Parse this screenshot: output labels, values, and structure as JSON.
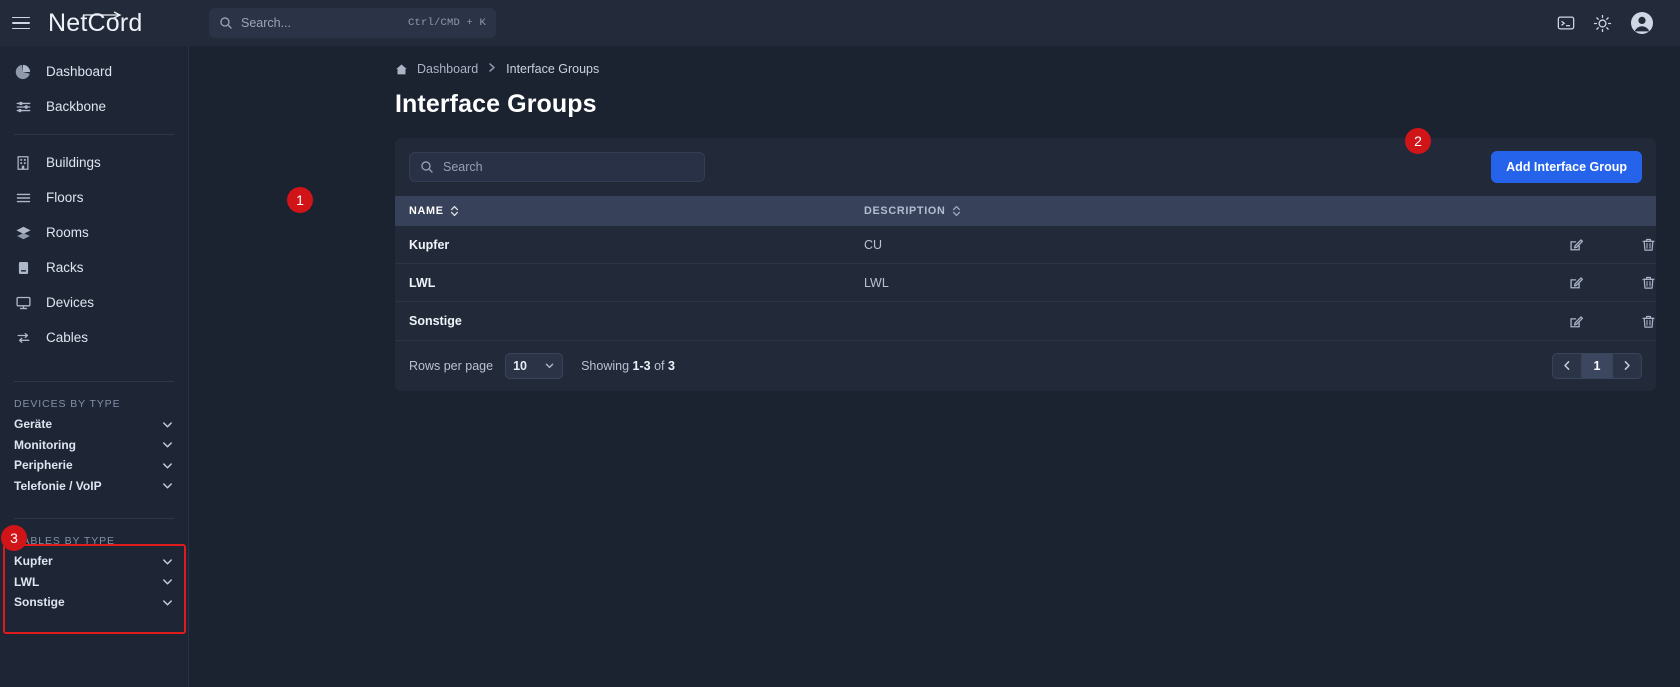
{
  "topbar": {
    "menu_icon": "hamburger-icon",
    "brand": "NetCord",
    "search": {
      "placeholder": "Search...",
      "shortcut": "Ctrl/CMD + K",
      "icon": "search-icon"
    },
    "actions": [
      {
        "name": "terminal-icon",
        "label": ""
      },
      {
        "name": "theme-toggle-icon",
        "label": ""
      },
      {
        "name": "user-avatar-icon",
        "label": ""
      }
    ]
  },
  "sidebar": {
    "primary": [
      {
        "label": "Dashboard",
        "icon": "pie-chart-icon"
      },
      {
        "label": "Backbone",
        "icon": "sliders-icon"
      }
    ],
    "secondary": [
      {
        "label": "Buildings",
        "icon": "building-icon"
      },
      {
        "label": "Floors",
        "icon": "layers-lines-icon"
      },
      {
        "label": "Rooms",
        "icon": "stack-icon"
      },
      {
        "label": "Racks",
        "icon": "rack-icon"
      },
      {
        "label": "Devices",
        "icon": "monitor-icon"
      },
      {
        "label": "Cables",
        "icon": "cable-swap-icon"
      }
    ],
    "devices_by_type": {
      "title": "DEVICES BY TYPE",
      "items": [
        {
          "label": "Geräte",
          "icon": "chevron-down-icon"
        },
        {
          "label": "Monitoring",
          "icon": "chevron-down-icon"
        },
        {
          "label": "Peripherie",
          "icon": "chevron-down-icon"
        },
        {
          "label": "Telefonie / VoIP",
          "icon": "chevron-down-icon"
        }
      ]
    },
    "cables_by_type": {
      "title": "CABLES BY TYPE",
      "items": [
        {
          "label": "Kupfer",
          "icon": "chevron-down-icon"
        },
        {
          "label": "LWL",
          "icon": "chevron-down-icon"
        },
        {
          "label": "Sonstige",
          "icon": "chevron-down-icon"
        }
      ]
    }
  },
  "breadcrumb": {
    "home_icon": "home-icon",
    "items": [
      "Dashboard",
      "Interface Groups"
    ],
    "separator": "›"
  },
  "page": {
    "title": "Interface Groups"
  },
  "toolbar": {
    "search_placeholder": "Search",
    "search_icon": "search-icon",
    "add_button": "Add Interface Group"
  },
  "table": {
    "columns": [
      {
        "key": "name",
        "label": "NAME",
        "sort_icon": "sort-updown-icon",
        "active": true
      },
      {
        "key": "description",
        "label": "DESCRIPTION",
        "sort_icon": "sort-updown-icon",
        "active": false
      }
    ],
    "rows": [
      {
        "name": "Kupfer",
        "description": "CU",
        "edit_icon": "edit-icon",
        "delete_icon": "trash-icon"
      },
      {
        "name": "LWL",
        "description": "LWL",
        "edit_icon": "edit-icon",
        "delete_icon": "trash-icon"
      },
      {
        "name": "Sonstige",
        "description": "",
        "edit_icon": "edit-icon",
        "delete_icon": "trash-icon"
      }
    ]
  },
  "footer": {
    "rows_per_page_label": "Rows per page",
    "rows_per_page_value": "10",
    "showing_prefix": "Showing",
    "showing_range": "1-3",
    "showing_middle": "of",
    "showing_total": "3",
    "prev_icon": "chevron-left-icon",
    "next_icon": "chevron-right-icon",
    "current_page": "1"
  },
  "annotations": [
    {
      "id": "1",
      "label": "1"
    },
    {
      "id": "2",
      "label": "2"
    },
    {
      "id": "3",
      "label": "3"
    }
  ],
  "colors": {
    "accent": "#2563eb",
    "annotation": "#d01417",
    "bg": "#1b2230",
    "panel": "#222a3a",
    "header_row": "#38415a"
  }
}
